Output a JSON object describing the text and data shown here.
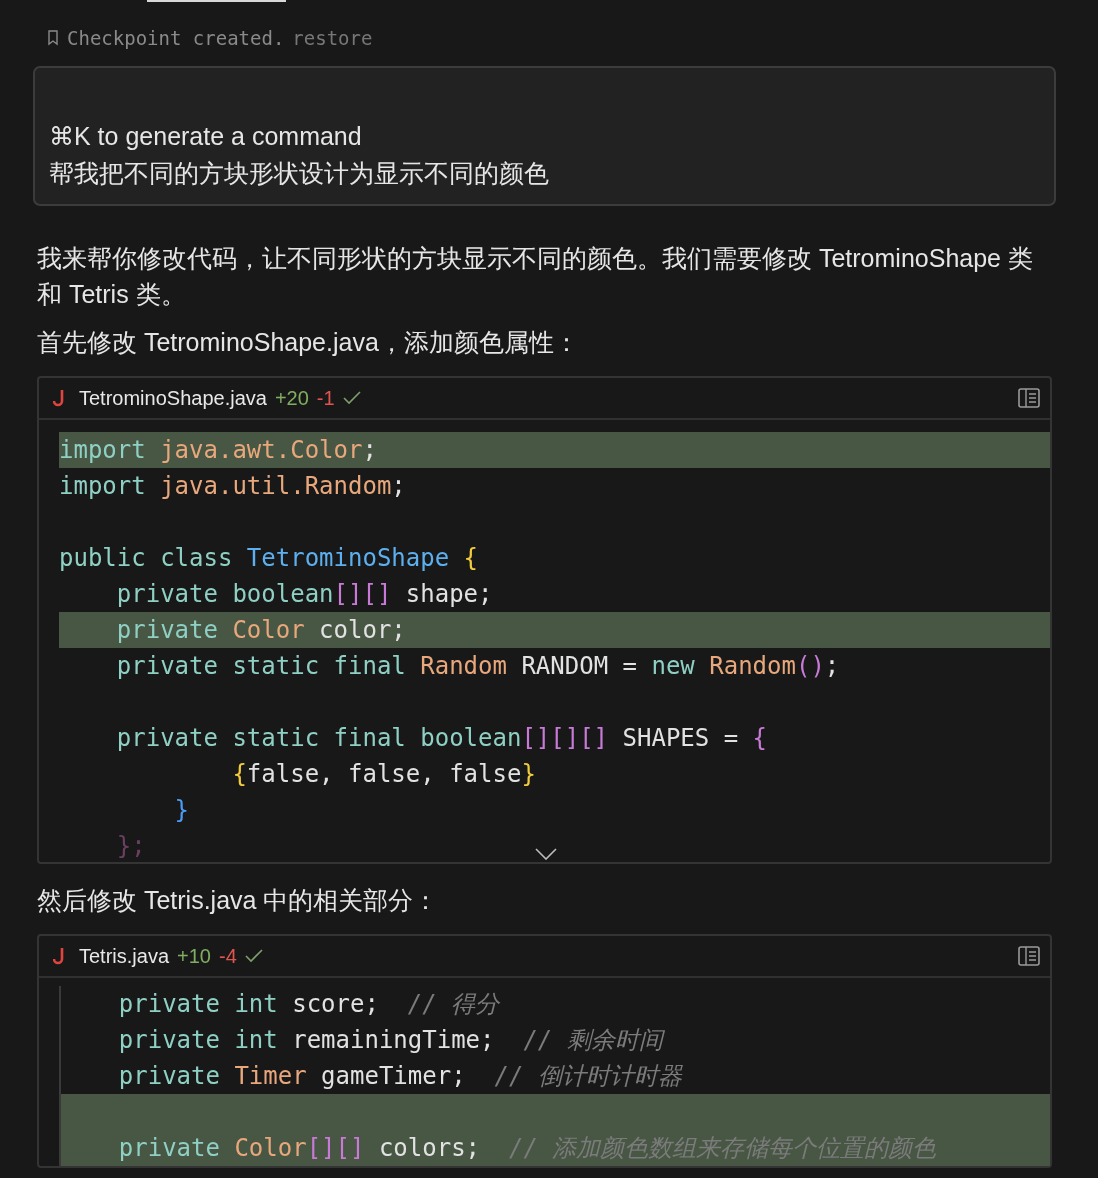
{
  "checkpoint": {
    "text": "Checkpoint created.",
    "action": "restore"
  },
  "prompt_box": {
    "hint": "⌘K to generate a command",
    "message": "帮我把不同的方块形状设计为显示不同的颜色"
  },
  "messages": [
    {
      "kind": "text",
      "text": "我来帮你修改代码，让不同形状的方块显示不同的颜色。我们需要修改 TetrominoShape 类和 Tetris 类。"
    },
    {
      "kind": "text",
      "text": "首先修改 TetrominoShape.java，添加颜色属性："
    },
    {
      "kind": "code",
      "file": "TetrominoShape.java",
      "added": "+20",
      "removed": "-1",
      "applied": true,
      "collapsed": true,
      "lines": [
        {
          "added": true,
          "tokens": [
            {
              "color": "#8fd0c4",
              "t": "import"
            },
            {
              "color": "#e8a87c",
              "t": " java.awt.Color"
            },
            {
              "color": "#e2e2e2",
              "t": ";"
            }
          ]
        },
        {
          "added": false,
          "tokens": [
            {
              "color": "#8fd0c4",
              "t": "import"
            },
            {
              "color": "#e8a87c",
              "t": " java.util.Random"
            },
            {
              "color": "#e2e2e2",
              "t": ";"
            }
          ]
        },
        {
          "added": false
        },
        {
          "added": false,
          "tokens": [
            {
              "color": "#8fd0c4",
              "t": "public class"
            },
            {
              "color": "#5db0f0",
              "t": " TetrominoShape"
            },
            {
              "color": "#f2cc3c",
              "t": " {"
            }
          ]
        },
        {
          "added": false,
          "tokens": [
            {
              "color": "#8fd0c4",
              "t": "    private boolean"
            },
            {
              "color": "#c77ad6",
              "t": "[][]"
            },
            {
              "color": "#e2e2e2",
              "t": " shape;"
            }
          ]
        },
        {
          "added": true,
          "tokens": [
            {
              "color": "#8fd0c4",
              "t": "    private"
            },
            {
              "color": "#e8a87c",
              "t": " Color"
            },
            {
              "color": "#e2e2e2",
              "t": " color;"
            }
          ]
        },
        {
          "added": false,
          "tokens": [
            {
              "color": "#8fd0c4",
              "t": "    private static final"
            },
            {
              "color": "#e8a87c",
              "t": " Random"
            },
            {
              "color": "#e2e2e2",
              "t": " RANDOM ="
            },
            {
              "color": "#8fd0c4",
              "t": " new"
            },
            {
              "color": "#e8a87c",
              "t": " Random"
            },
            {
              "color": "#c77ad6",
              "t": "()"
            },
            {
              "color": "#e2e2e2",
              "t": ";"
            }
          ]
        },
        {
          "added": false
        },
        {
          "added": false,
          "tokens": [
            {
              "color": "#8fd0c4",
              "t": "    private static final boolean"
            },
            {
              "color": "#c77ad6",
              "t": "[][][]"
            },
            {
              "color": "#e2e2e2",
              "t": " SHAPES ="
            },
            {
              "color": "#c77ad6",
              "t": " {"
            }
          ]
        },
        {
          "added": false,
          "tokens": [
            {
              "color": "#f2cc3c",
              "t": "            {"
            },
            {
              "color": "#e2e2e2",
              "t": "false, false, false"
            },
            {
              "color": "#f2cc3c",
              "t": "}"
            }
          ]
        },
        {
          "added": false,
          "tokens": [
            {
              "color": "#4c9cf5",
              "t": "        }"
            }
          ]
        },
        {
          "added": false,
          "tokens": [
            {
              "color": "#6a3f62",
              "t": "    };"
            }
          ]
        }
      ]
    },
    {
      "kind": "text",
      "text": "然后修改 Tetris.java 中的相关部分："
    },
    {
      "kind": "code",
      "file": "Tetris.java",
      "added": "+10",
      "removed": "-4",
      "applied": true,
      "collapsed": false,
      "lines": [
        {
          "added": false,
          "tokens": [
            {
              "color": "#8fd0c4",
              "t": "    private int"
            },
            {
              "color": "#e2e2e2",
              "t": " score;"
            },
            {
              "color": "#7b7b7b",
              "t": "  // 得分"
            }
          ]
        },
        {
          "added": false,
          "tokens": [
            {
              "color": "#8fd0c4",
              "t": "    private int"
            },
            {
              "color": "#e2e2e2",
              "t": " remainingTime;"
            },
            {
              "color": "#7b7b7b",
              "t": "  // 剩余时间"
            }
          ]
        },
        {
          "added": false,
          "tokens": [
            {
              "color": "#8fd0c4",
              "t": "    private"
            },
            {
              "color": "#e8a87c",
              "t": " Timer"
            },
            {
              "color": "#e2e2e2",
              "t": " gameTimer;"
            },
            {
              "color": "#7b7b7b",
              "t": "  // 倒计时计时器"
            }
          ]
        },
        {
          "added": true
        },
        {
          "added": true,
          "tokens": [
            {
              "color": "#8fd0c4",
              "t": "    private"
            },
            {
              "color": "#e8a87c",
              "t": " Color"
            },
            {
              "color": "#c77ad6",
              "t": "[][]"
            },
            {
              "color": "#e2e2e2",
              "t": " colors;"
            },
            {
              "color": "#7b7b7b",
              "t": "  // 添加颜色数组来存储每个位置的颜色"
            }
          ]
        }
      ]
    }
  ]
}
